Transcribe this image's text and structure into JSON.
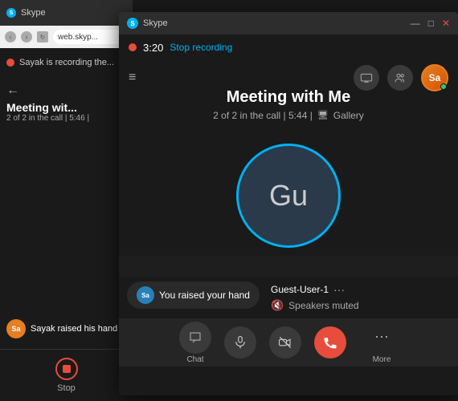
{
  "bgWindow": {
    "tabIcon": "S",
    "tabLabel": "Skype",
    "navUrl": "web.skyp...",
    "recordingText": "Sayak is recording the...",
    "backBtn": "←",
    "meetingTitle": "Meeting wit...",
    "meetingSubtitle": "2 of 2 in the call | 5:46 |",
    "notification": {
      "avatarText": "Sa",
      "text": "Sayak raised his hand"
    },
    "stopLabel": "Stop"
  },
  "mainWindow": {
    "titleBar": {
      "tabIcon": "S",
      "tabLabel": "Skype",
      "minimize": "—",
      "maximize": "□",
      "close": "✕"
    },
    "recordingBar": {
      "time": "3:20",
      "stopLabel": "Stop recording"
    },
    "callHeader": {
      "hamburger": "≡",
      "avatarText": "Sa"
    },
    "callInfo": {
      "title": "Meeting with Me",
      "subtitle": "2 of 2 in the call | 5:44 |",
      "galleryLabel": "Gallery"
    },
    "participant": {
      "initials": "Gu"
    },
    "handNotification": {
      "avatarText": "Sa",
      "text": "You raised your hand"
    },
    "guestInfo": {
      "name": "Guest-User-1",
      "menuDots": "···",
      "speakerMuted": "Speakers muted"
    },
    "controls": {
      "chatLabel": "Chat",
      "muteLabel": "",
      "videoLabel": "",
      "endLabel": "",
      "moreLabel": "More"
    }
  }
}
